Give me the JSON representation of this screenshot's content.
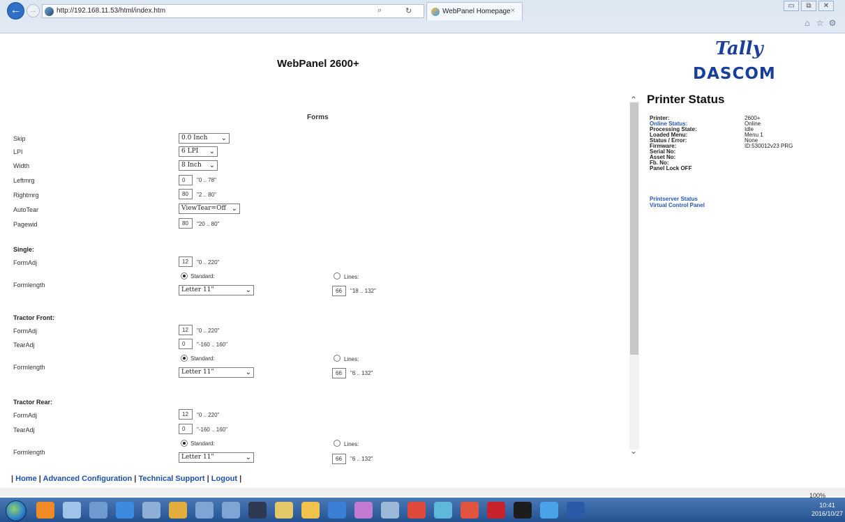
{
  "browser": {
    "url": "http://192.168.11.53/html/index.htm",
    "tab_title": "WebPanel Homepage",
    "tab_close": "×",
    "back_icon": "back-arrow-icon",
    "search_glyph": "⌕",
    "refresh_glyph": "↻",
    "win_min": "▭",
    "win_max": "⧉",
    "win_close": "✕"
  },
  "page": {
    "title": "WebPanel 2600+",
    "logo_top": "Tally",
    "logo_bottom": "DASCOM",
    "section": "Forms"
  },
  "forms": {
    "skip": {
      "label": "Skip",
      "value": "0.0 Inch"
    },
    "lpi": {
      "label": "LPI",
      "value": "6 LPI"
    },
    "width": {
      "label": "Width",
      "value": "8 Inch"
    },
    "leftmrg": {
      "label": "Leftmrg",
      "value": "0",
      "hint": "\"0 .. 78\""
    },
    "rightmrg": {
      "label": "Rightmrg",
      "value": "80",
      "hint": "\"2 .. 80\""
    },
    "autotear": {
      "label": "AutoTear",
      "value": "ViewTear=Off"
    },
    "pagewid": {
      "label": "Pagewid",
      "value": "80",
      "hint": "\"20 .. 80\""
    }
  },
  "single": {
    "heading": "Single:",
    "formadj": {
      "label": "FormAdj",
      "value": "12",
      "hint": "\"0 .. 220\""
    },
    "formlength": {
      "label": "Formlength",
      "standard": "Standard:",
      "select": "Letter 11\"",
      "lines": "Lines:",
      "lines_value": "66",
      "lines_hint": "\"18 .. 132\""
    }
  },
  "tractor_front": {
    "heading": "Tractor Front:",
    "formadj": {
      "label": "FormAdj",
      "value": "12",
      "hint": "\"0 .. 220\""
    },
    "tearadj": {
      "label": "TearAdj",
      "value": "0",
      "hint": "\"-160 .. 160\""
    },
    "formlength": {
      "label": "Formlength",
      "standard": "Standard:",
      "select": "Letter 11\"",
      "lines": "Lines:",
      "lines_value": "66",
      "lines_hint": "\"6 .. 132\""
    }
  },
  "tractor_rear": {
    "heading": "Tractor Rear:",
    "formadj": {
      "label": "FormAdj",
      "value": "12",
      "hint": "\"0 .. 220\""
    },
    "tearadj": {
      "label": "TearAdj",
      "value": "0",
      "hint": "\"-160 .. 160\""
    },
    "formlength": {
      "label": "Formlength",
      "standard": "Standard:",
      "select": "Letter 11\"",
      "lines": "Lines:",
      "lines_value": "66",
      "lines_hint": "\"6 .. 132\""
    }
  },
  "footer": {
    "pre": "|",
    "home": "Home",
    "advanced": "Advanced Configuration",
    "support": "Technical Support",
    "logout": "Logout",
    "sep": "|"
  },
  "status": {
    "title": "Printer Status",
    "rows": [
      {
        "label": "Printer:",
        "value": "2600+"
      },
      {
        "label": "Online Status:",
        "value": "Online"
      },
      {
        "label": "Processing State:",
        "value": "Idle"
      },
      {
        "label": "Loaded Menu:",
        "value": "Menu 1"
      },
      {
        "label": "Status / Error:",
        "value": "None"
      },
      {
        "label": "Firmware:",
        "value": "ID:530012v23 PRG"
      },
      {
        "label": "Serial No:",
        "value": ""
      },
      {
        "label": "Asset No:",
        "value": ""
      },
      {
        "label": "Fb. No:",
        "value": ""
      },
      {
        "label": "Panel Lock OFF",
        "value": ""
      }
    ],
    "link_printserver": "Printserver Status",
    "link_virtual": "Virtual Control Panel"
  },
  "statusbar": {
    "zoom": "100%"
  },
  "taskbar": {
    "time": "10:41",
    "date": "2016/10/27"
  },
  "colors": {
    "link": "#1f4fa8",
    "logo": "#1a3f9b",
    "taskbar": "#2c5a99"
  }
}
